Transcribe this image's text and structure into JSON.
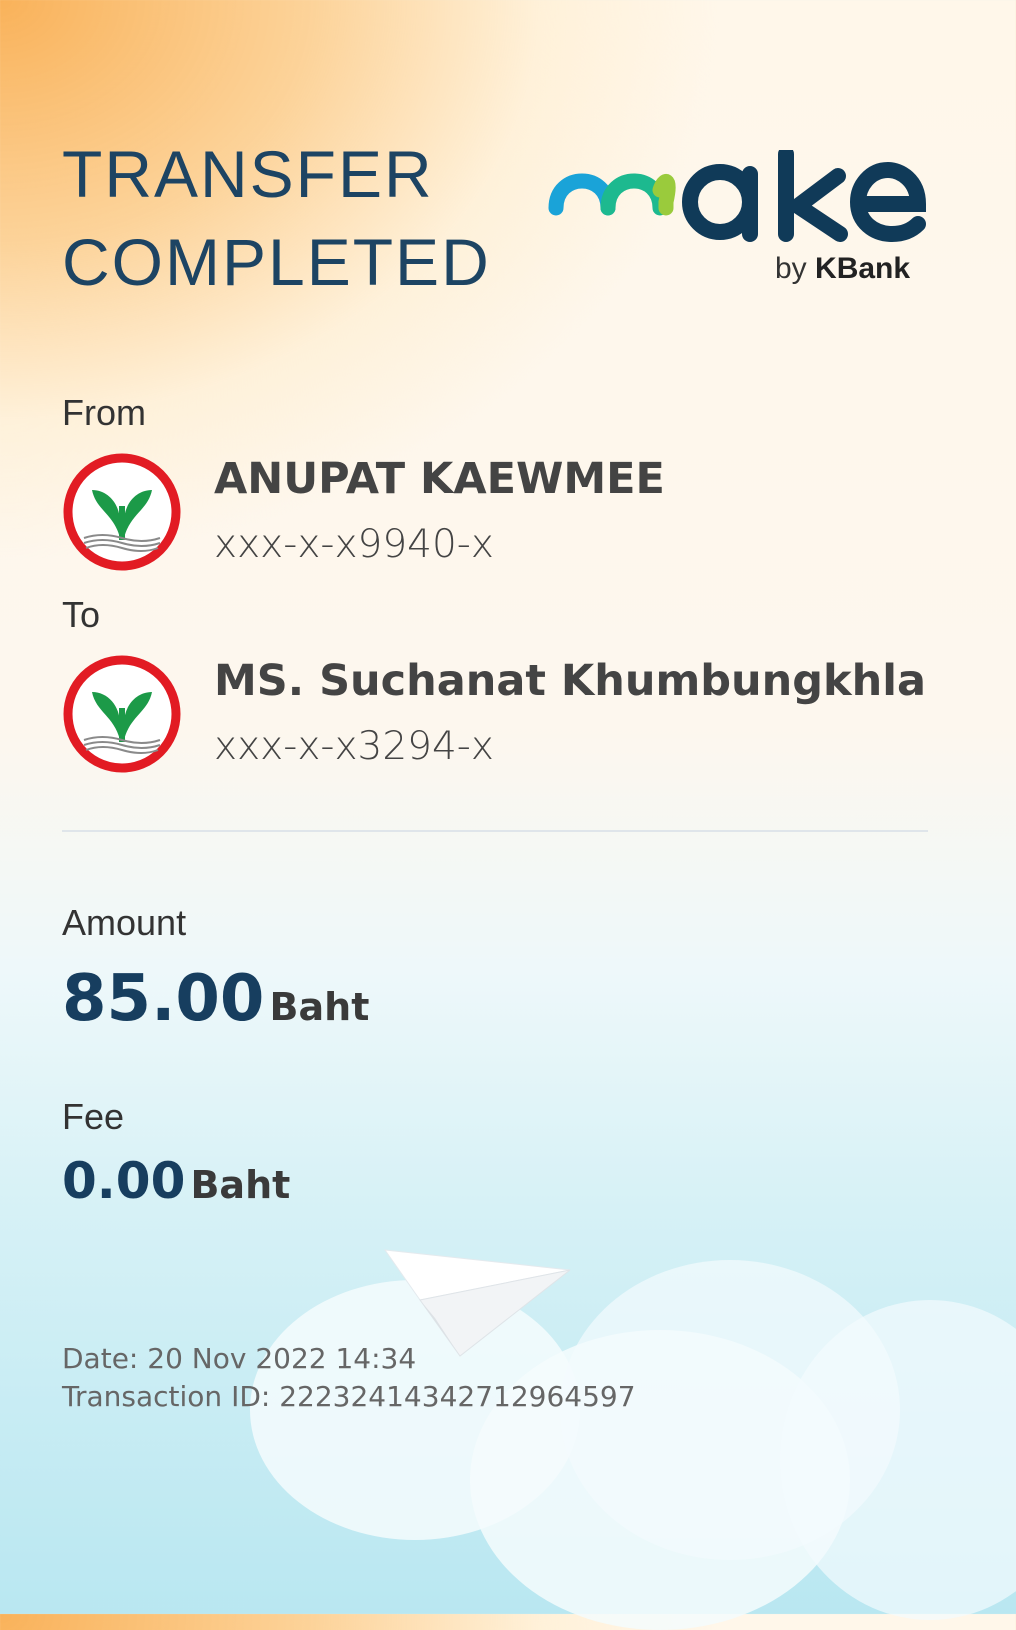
{
  "header": {
    "title_line1": "TRANSFER",
    "title_line2": "COMPLETED",
    "brand_name": "make",
    "brand_by": "by",
    "brand_bank": "KBank"
  },
  "from": {
    "label": "From",
    "name": "ANUPAT KAEWMEE",
    "account": "xxx-x-x9940-x"
  },
  "to": {
    "label": "To",
    "name": "MS. Suchanat Khumbungkhla",
    "account": "xxx-x-x3294-x"
  },
  "amount": {
    "label": "Amount",
    "value": "85.00",
    "unit": "Baht"
  },
  "fee": {
    "label": "Fee",
    "value": "0.00",
    "unit": "Baht"
  },
  "footer": {
    "date": "Date: 20 Nov 2022 14:34",
    "transaction_id": "Transaction ID: 2223241434271296459​7"
  },
  "colors": {
    "title": "#1d4463",
    "amount": "#173e5f",
    "logo_ring": "#e21b23",
    "logo_leaf": "#1c9a48"
  }
}
